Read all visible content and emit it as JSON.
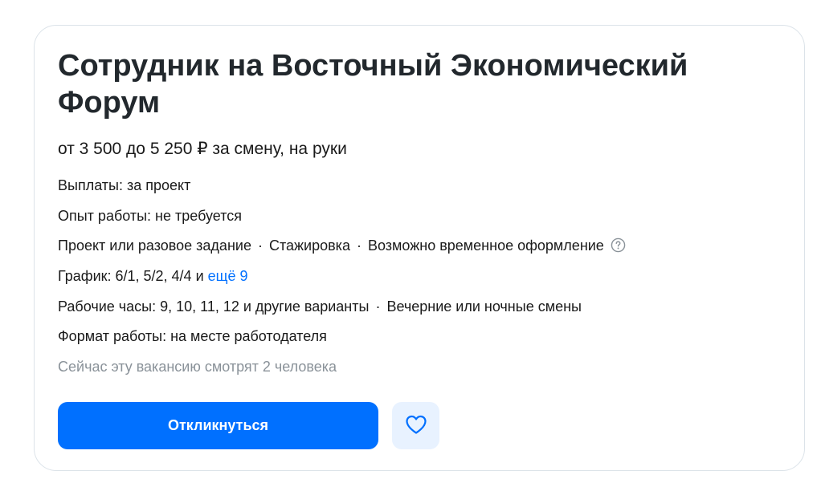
{
  "vacancy": {
    "title": "Сотрудник на Восточный Экономический Форум",
    "salary": "от 3 500 до 5 250 ₽ за смену, на руки",
    "payments": "Выплаты: за проект",
    "experience": "Опыт работы: не требуется",
    "employment_types": [
      "Проект или разовое задание",
      "Стажировка",
      "Возможно временное оформление"
    ],
    "separator": "·",
    "schedule_label": "График: 6/1, 5/2, 4/4 и ",
    "schedule_more": "ещё 9",
    "work_hours": "Рабочие часы: 9, 10, 11, 12 и другие варианты",
    "shifts": "Вечерние или ночные смены",
    "work_format": "Формат работы: на месте работодателя",
    "viewers": "Сейчас эту вакансию смотрят 2 человека"
  },
  "actions": {
    "apply_label": "Откликнуться",
    "favorite_icon": "heart-icon"
  },
  "colors": {
    "accent": "#0070ff",
    "favorite_bg": "#e8f2ff",
    "muted_text": "#8a9299",
    "card_border": "#dce3e9"
  }
}
